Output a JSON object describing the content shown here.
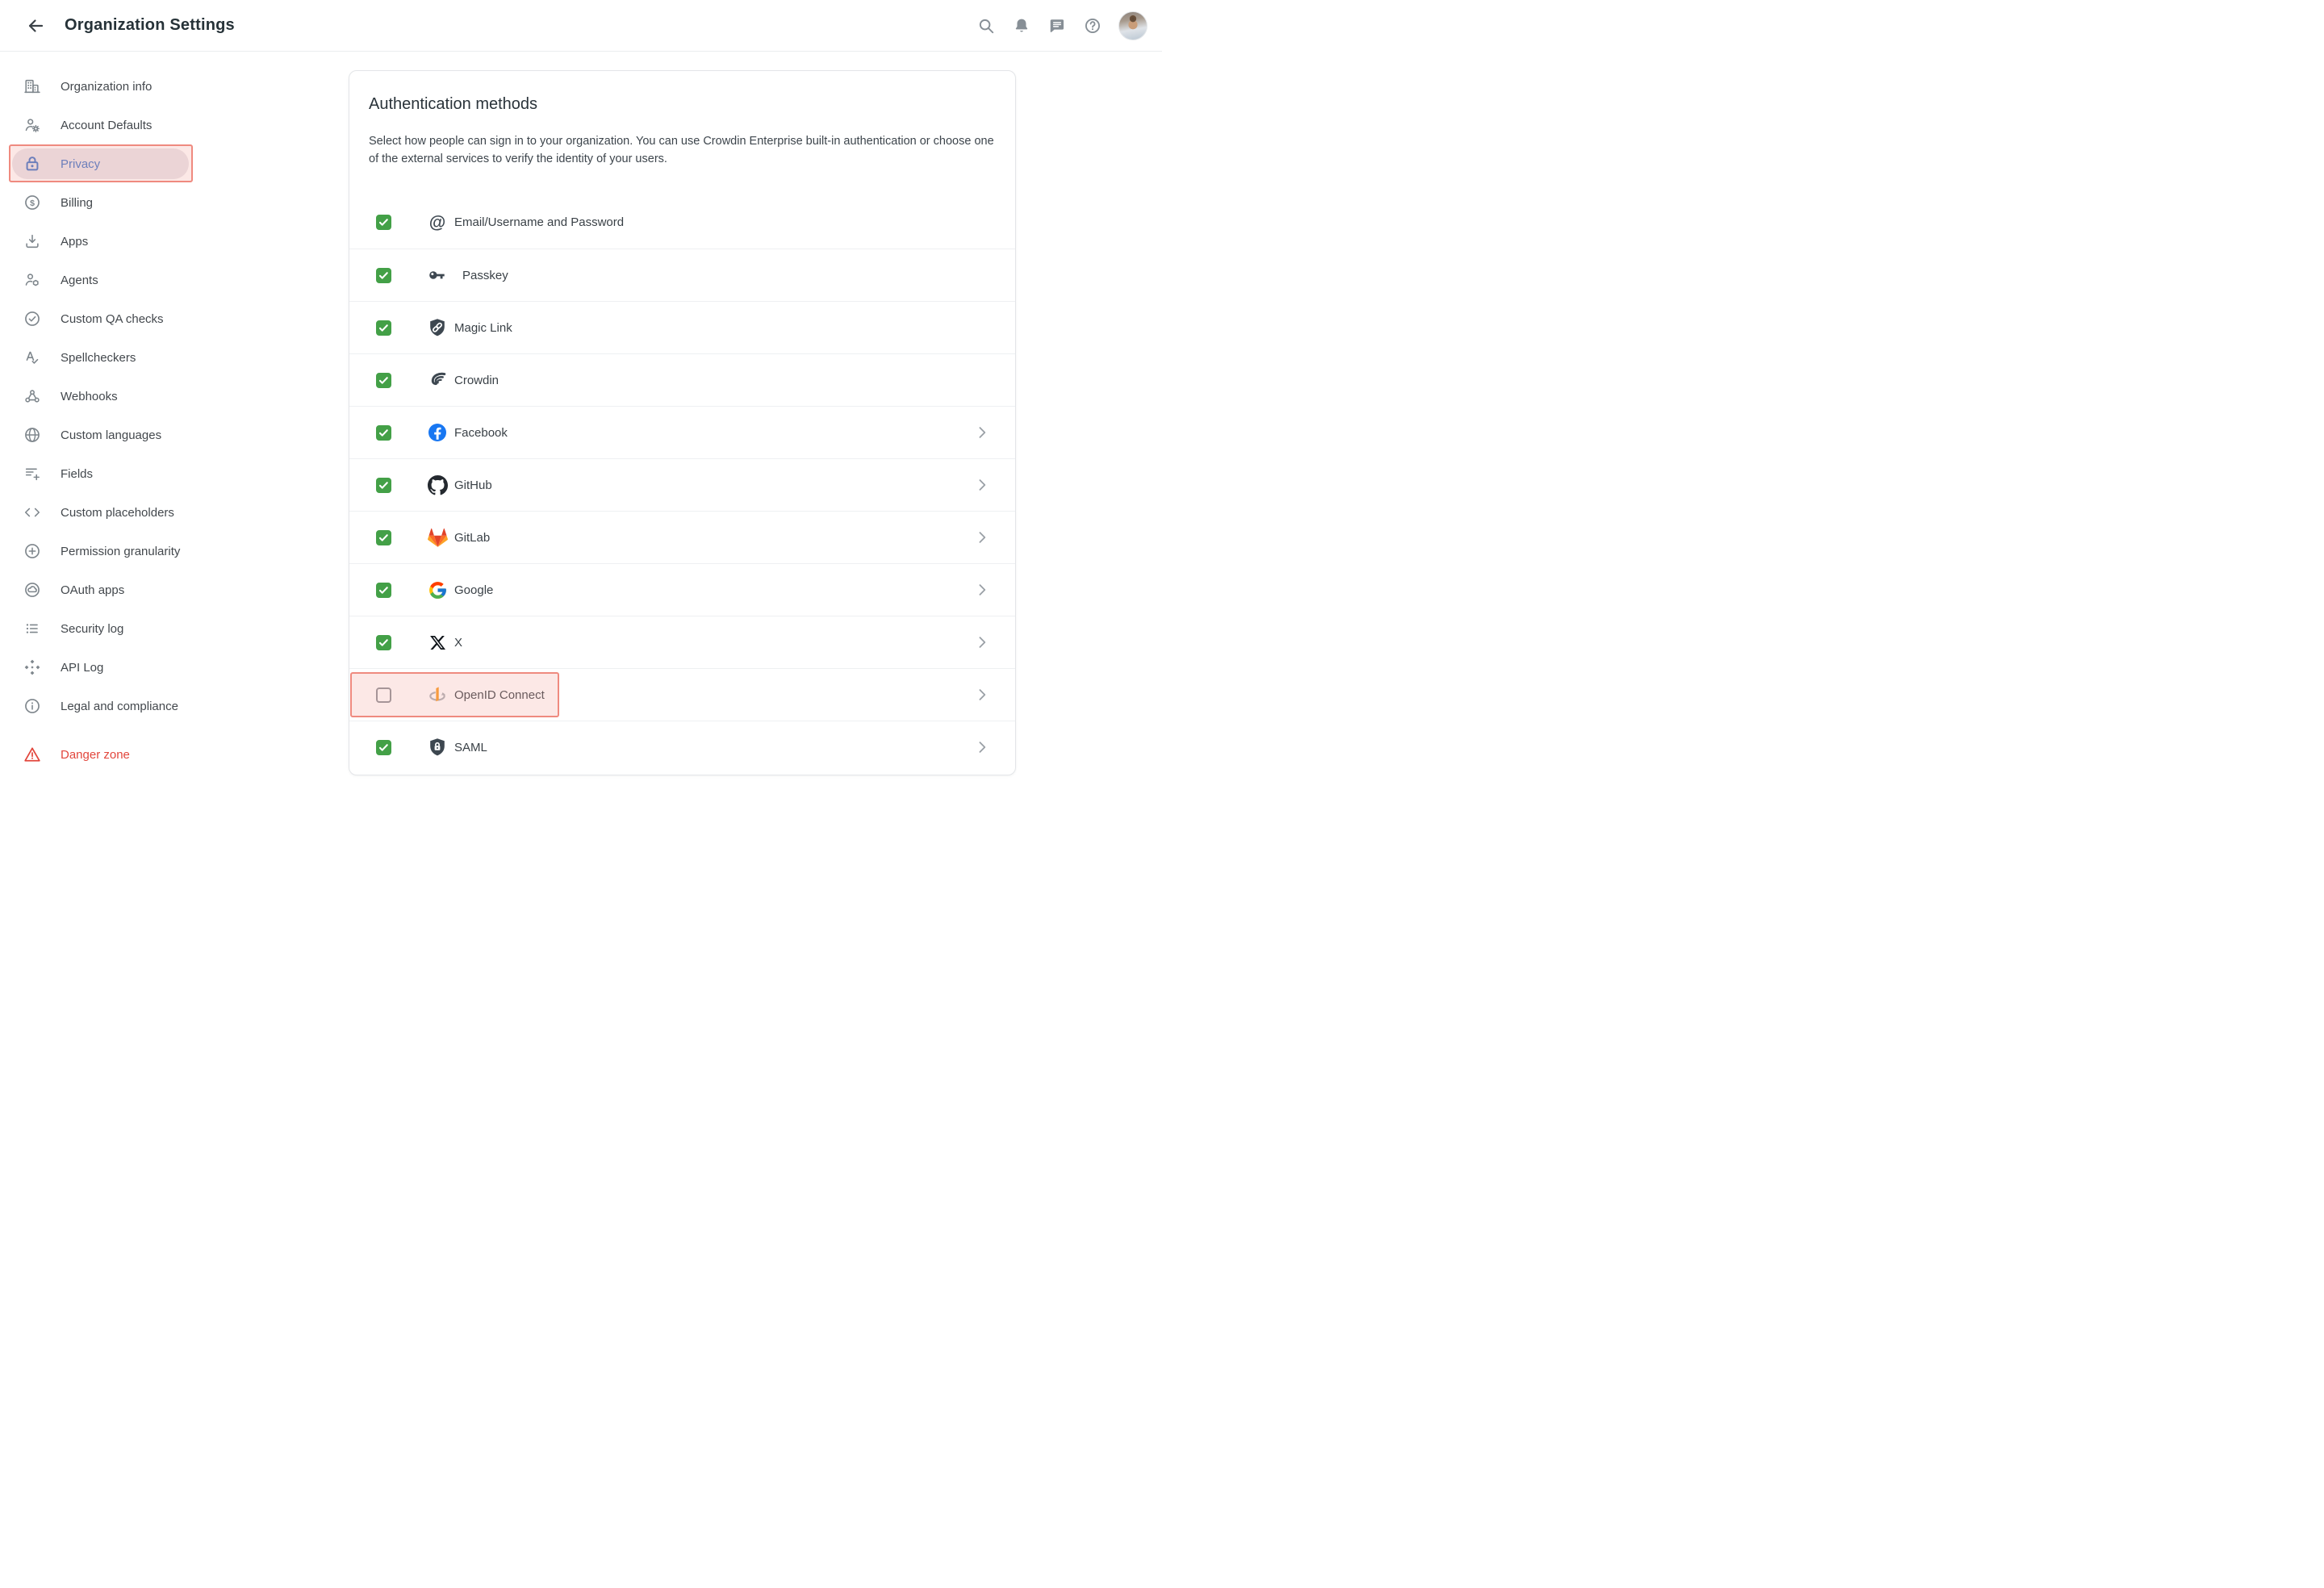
{
  "header": {
    "title": "Organization Settings",
    "back_icon": "back-arrow-icon",
    "icons": [
      {
        "icon": "search-icon"
      },
      {
        "icon": "bell-icon"
      },
      {
        "icon": "chat-icon"
      },
      {
        "icon": "help-icon"
      }
    ],
    "avatar": "user-avatar"
  },
  "sidebar": {
    "items": [
      {
        "label": "Organization info",
        "icon": "building-icon"
      },
      {
        "label": "Account Defaults",
        "icon": "person-gear-icon"
      },
      {
        "label": "Privacy",
        "icon": "lock-icon",
        "selected": true,
        "annotated": true
      },
      {
        "label": "Billing",
        "icon": "dollar-circle-icon"
      },
      {
        "label": "Apps",
        "icon": "download-icon"
      },
      {
        "label": "Agents",
        "icon": "person-cube-icon"
      },
      {
        "label": "Custom QA checks",
        "icon": "check-circle-icon"
      },
      {
        "label": "Spellcheckers",
        "icon": "spellcheck-icon"
      },
      {
        "label": "Webhooks",
        "icon": "webhook-icon"
      },
      {
        "label": "Custom languages",
        "icon": "globe-icon"
      },
      {
        "label": "Fields",
        "icon": "list-plus-icon"
      },
      {
        "label": "Custom placeholders",
        "icon": "code-brackets-icon"
      },
      {
        "label": "Permission granularity",
        "icon": "plus-circle-icon"
      },
      {
        "label": "OAuth apps",
        "icon": "cloud-circle-icon"
      },
      {
        "label": "Security log",
        "icon": "bullet-list-icon"
      },
      {
        "label": "API Log",
        "icon": "api-diamonds-icon"
      },
      {
        "label": "Legal and compliance",
        "icon": "info-circle-icon"
      },
      {
        "label": "Danger zone",
        "icon": "warning-triangle-icon",
        "danger": true
      }
    ]
  },
  "panel": {
    "title": "Authentication methods",
    "description": "Select how people can sign in to your organization. You can use Crowdin Enterprise built-in authentication or choose one of the external services to verify the identity of your users."
  },
  "methods": [
    {
      "label": "Email/Username and Password",
      "icon": "at-icon",
      "checked": true,
      "chevron": false
    },
    {
      "label": "Passkey",
      "icon": "key-icon",
      "checked": true,
      "chevron": false,
      "indent": true
    },
    {
      "label": "Magic Link",
      "icon": "shield-link-icon",
      "checked": true,
      "chevron": false
    },
    {
      "label": "Crowdin",
      "icon": "crowdin-icon",
      "checked": true,
      "chevron": false
    },
    {
      "label": "Facebook",
      "icon": "facebook-icon",
      "checked": true,
      "chevron": true
    },
    {
      "label": "GitHub",
      "icon": "github-icon",
      "checked": true,
      "chevron": true
    },
    {
      "label": "GitLab",
      "icon": "gitlab-icon",
      "checked": true,
      "chevron": true
    },
    {
      "label": "Google",
      "icon": "google-icon",
      "checked": true,
      "chevron": true
    },
    {
      "label": "X",
      "icon": "x-icon",
      "checked": true,
      "chevron": true
    },
    {
      "label": "OpenID Connect",
      "icon": "openid-icon",
      "checked": false,
      "chevron": true,
      "annotated": true
    },
    {
      "label": "SAML",
      "icon": "shield-lock-icon",
      "checked": true,
      "chevron": true
    }
  ],
  "annotations": {
    "highlighted_sidebar_item": "Privacy",
    "highlighted_method": "OpenID Connect"
  },
  "colors": {
    "accent_blue": "#3e72c6",
    "checkbox_green": "#43a047",
    "danger_red": "#e2463c",
    "annotation_border": "#ef8a7f",
    "selected_pill": "#e9e5ea",
    "facebook_blue": "#1877F2"
  }
}
